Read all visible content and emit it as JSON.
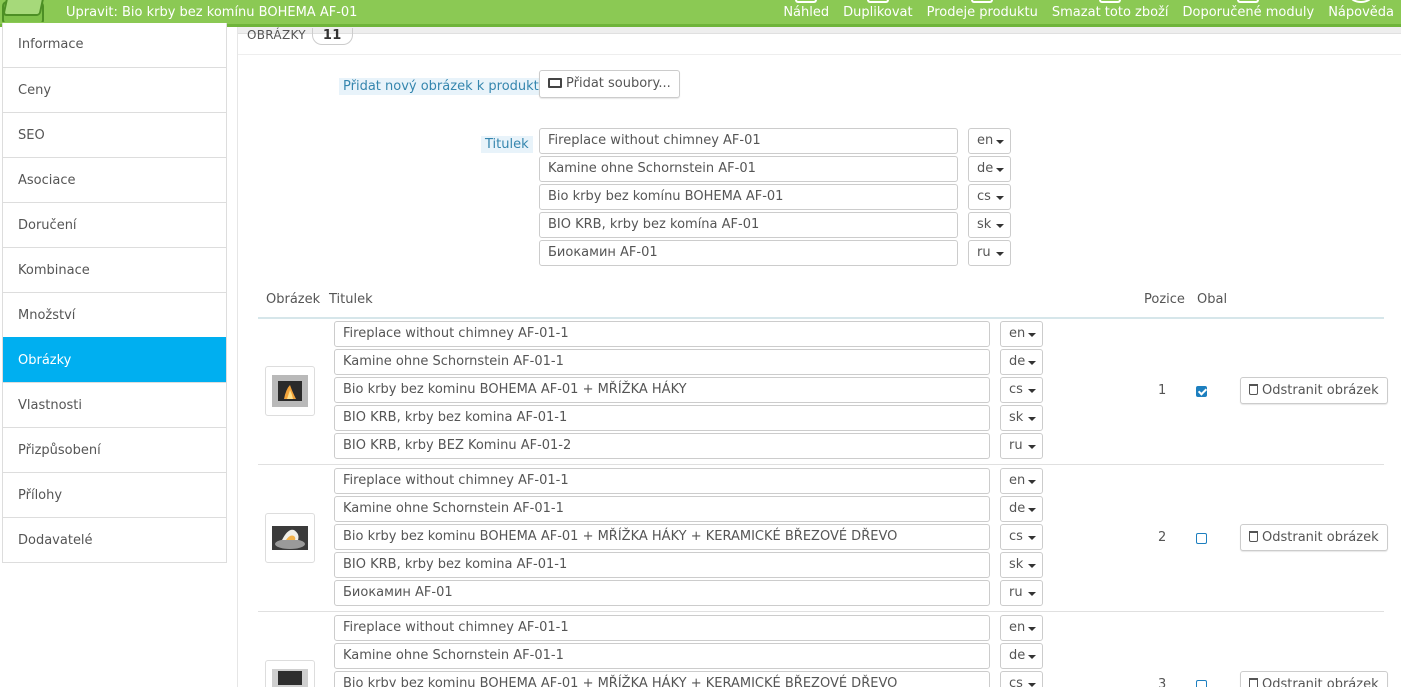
{
  "header": {
    "title": "Upravit: Bio krby bez komínu BOHEMA AF-01",
    "toolbar": [
      {
        "label": "Náhled",
        "icon": "eye-icon"
      },
      {
        "label": "Duplikovat",
        "icon": "copy-icon"
      },
      {
        "label": "Prodeje produktu",
        "icon": "chart-icon"
      },
      {
        "label": "Smazat toto zboží",
        "icon": "trash-icon"
      },
      {
        "label": "Doporučené moduly",
        "icon": "puzzle-icon"
      },
      {
        "label": "Nápověda",
        "icon": "help-icon"
      }
    ],
    "color": "#8bc954"
  },
  "sidebar": {
    "items": [
      {
        "label": "Informace"
      },
      {
        "label": "Ceny"
      },
      {
        "label": "SEO"
      },
      {
        "label": "Asociace"
      },
      {
        "label": "Doručení"
      },
      {
        "label": "Kombinace"
      },
      {
        "label": "Množství"
      },
      {
        "label": "Obrázky",
        "active": true
      },
      {
        "label": "Vlastnosti"
      },
      {
        "label": "Přizpůsobení"
      },
      {
        "label": "Přílohy"
      },
      {
        "label": "Dodavatelé"
      }
    ],
    "active_color": "#00aff0"
  },
  "main": {
    "heading": "OBRÁZKY",
    "count": "11",
    "add_label": "Přidat nový obrázek k produktu",
    "add_button": "Přidat soubory...",
    "title_label": "Titulek",
    "new_titles": [
      {
        "value": "Fireplace without chimney AF-01",
        "lang": "en"
      },
      {
        "value": "Kamine ohne Schornstein AF-01",
        "lang": "de"
      },
      {
        "value": "Bio krby bez komínu BOHEMA AF-01",
        "lang": "cs"
      },
      {
        "value": "BIO KRB, krby bez komína AF-01",
        "lang": "sk"
      },
      {
        "value": "Биокамин AF-01",
        "lang": "ru"
      }
    ],
    "table": {
      "columns": {
        "image": "Obrázek",
        "title": "Titulek",
        "position": "Pozice",
        "cover": "Obal"
      },
      "delete_label": "Odstranit obrázek",
      "rows": [
        {
          "position": "1",
          "cover": true,
          "titles": [
            {
              "value": "Fireplace without chimney AF-01-1",
              "lang": "en"
            },
            {
              "value": "Kamine ohne Schornstein AF-01-1",
              "lang": "de"
            },
            {
              "value": "Bio krby bez kominu BOHEMA AF-01 + MŘÍŽKA HÁKY",
              "lang": "cs"
            },
            {
              "value": "BIO KRB, krby bez komina AF-01-1",
              "lang": "sk"
            },
            {
              "value": "BIO KRB, krby BEZ Kominu AF-01-2",
              "lang": "ru"
            }
          ]
        },
        {
          "position": "2",
          "cover": false,
          "titles": [
            {
              "value": "Fireplace without chimney AF-01-1",
              "lang": "en"
            },
            {
              "value": "Kamine ohne Schornstein AF-01-1",
              "lang": "de"
            },
            {
              "value": "Bio krby bez kominu BOHEMA AF-01 + MŘÍŽKA HÁKY  + KERAMICKÉ BŘEZOVÉ DŘEVO",
              "lang": "cs"
            },
            {
              "value": "BIO KRB, krby bez komina AF-01-1",
              "lang": "sk"
            },
            {
              "value": "Биокамин AF-01",
              "lang": "ru"
            }
          ]
        },
        {
          "position": "3",
          "cover": false,
          "titles": [
            {
              "value": "Fireplace without chimney AF-01-1",
              "lang": "en"
            },
            {
              "value": "Kamine ohne Schornstein AF-01-1",
              "lang": "de"
            },
            {
              "value": "Bio krby bez kominu BOHEMA AF-01 + MŘÍŽKA HÁKY + KERAMICKÉ BŘEZOVÉ DŘEVO",
              "lang": "cs"
            }
          ]
        }
      ]
    }
  }
}
